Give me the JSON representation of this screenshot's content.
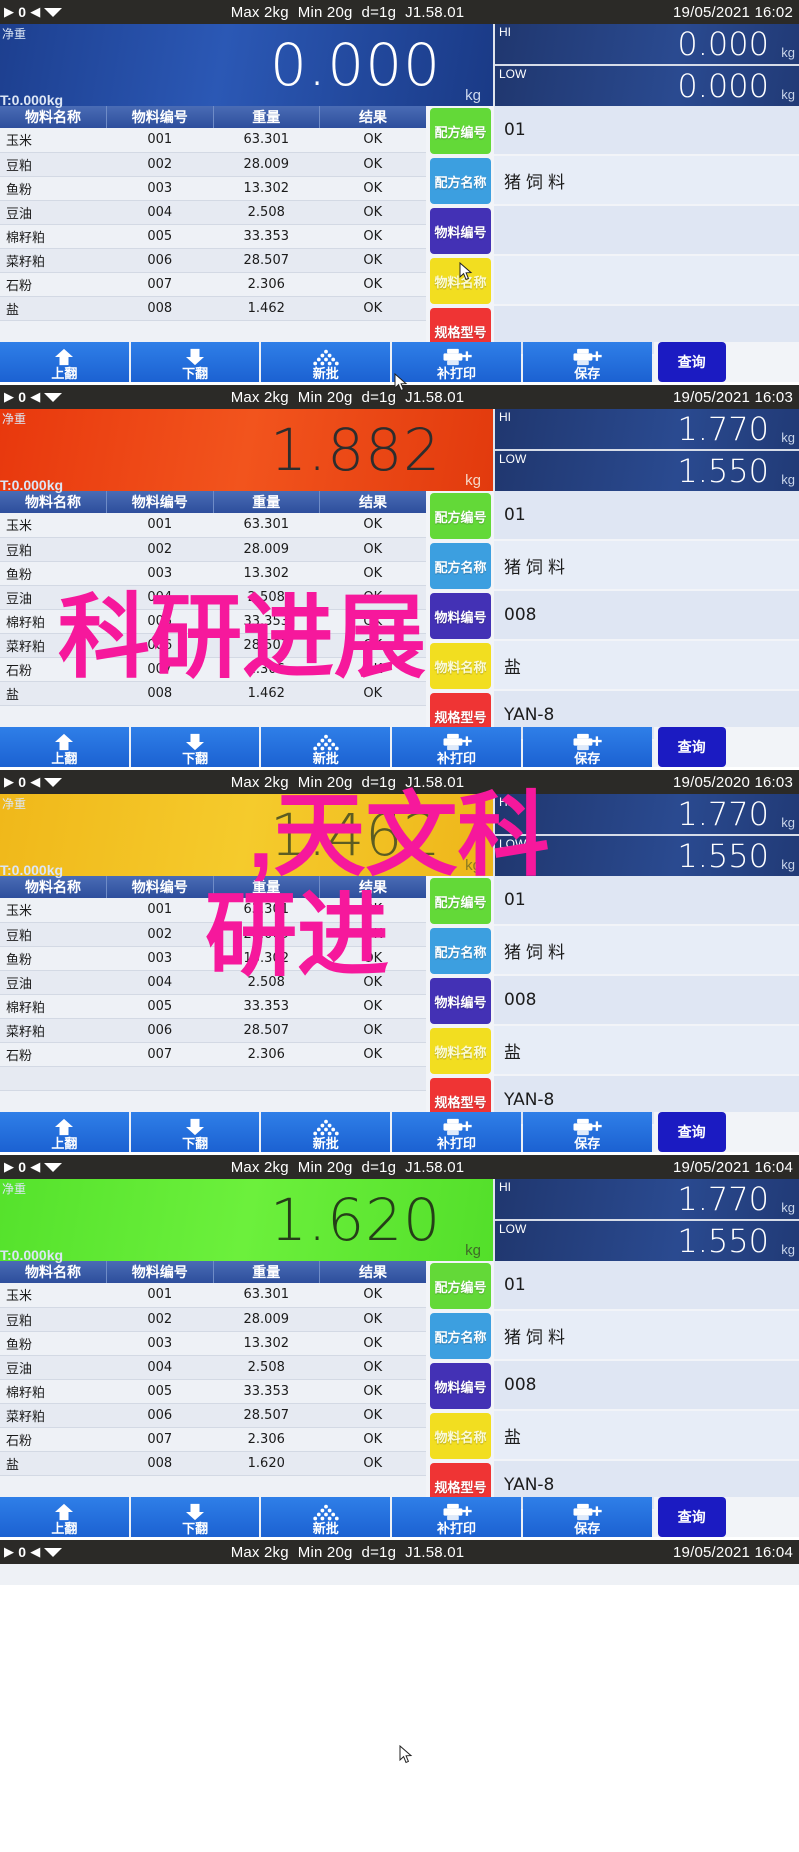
{
  "statusbar": {
    "indicator_zero": "0",
    "spec_max": "Max 2kg",
    "spec_min": "Min 20g",
    "spec_d": "d=1g",
    "firmware": "J1.58.01"
  },
  "table_headers": [
    "物料名称",
    "物料编号",
    "重量",
    "结果"
  ],
  "labels": {
    "net": "净重",
    "tare": "T:0.000kg",
    "unit_kg": "kg",
    "hi": "HI",
    "low": "LOW"
  },
  "keys": {
    "formula_no": "配方编号",
    "formula_name": "配方名称",
    "material_no": "物料编号",
    "material_name": "物料名称",
    "spec_model": "规格型号",
    "query": "查询"
  },
  "toolbar": [
    {
      "label": "上翻",
      "icon": "arrow-up-icon"
    },
    {
      "label": "下翻",
      "icon": "arrow-down-icon"
    },
    {
      "label": "新批",
      "icon": "stack-icon"
    },
    {
      "label": "补打印",
      "icon": "printer-plus-icon"
    },
    {
      "label": "保存",
      "icon": "printer-save-icon"
    }
  ],
  "panels": [
    {
      "id": "panel-1",
      "datetime": "19/05/2021 16:02",
      "weight": "0.000",
      "weight_color": "blue",
      "hi": "0.000",
      "low": "0.000",
      "rows": [
        [
          "玉米",
          "001",
          "63.301",
          "OK"
        ],
        [
          "豆粕",
          "002",
          "28.009",
          "OK"
        ],
        [
          "鱼粉",
          "003",
          "13.302",
          "OK"
        ],
        [
          "豆油",
          "004",
          "2.508",
          "OK"
        ],
        [
          "棉籽粕",
          "005",
          "33.353",
          "OK"
        ],
        [
          "菜籽粕",
          "006",
          "28.507",
          "OK"
        ],
        [
          "石粉",
          "007",
          "2.306",
          "OK"
        ],
        [
          "盐",
          "008",
          "1.462",
          "OK"
        ]
      ],
      "values": {
        "formula_no": "01",
        "formula_name": "猪饲料",
        "material_no": "",
        "material_name": "",
        "spec_model": ""
      }
    },
    {
      "id": "panel-2",
      "datetime": "19/05/2021 16:03",
      "weight": "1.882",
      "weight_color": "red",
      "hi": "1.770",
      "low": "1.550",
      "rows": [
        [
          "玉米",
          "001",
          "63.301",
          "OK"
        ],
        [
          "豆粕",
          "002",
          "28.009",
          "OK"
        ],
        [
          "鱼粉",
          "003",
          "13.302",
          "OK"
        ],
        [
          "豆油",
          "004",
          "2.508",
          "OK"
        ],
        [
          "棉籽粕",
          "005",
          "33.353",
          "OK"
        ],
        [
          "菜籽粕",
          "006",
          "28.507",
          "OK"
        ],
        [
          "石粉",
          "007",
          "2.306",
          "OK"
        ],
        [
          "盐",
          "008",
          "1.462",
          "OK"
        ]
      ],
      "values": {
        "formula_no": "01",
        "formula_name": "猪饲料",
        "material_no": "008",
        "material_name": "盐",
        "spec_model": "YAN-8"
      }
    },
    {
      "id": "panel-3",
      "datetime": "19/05/2020 16:03",
      "weight": "1.462",
      "weight_color": "yellow",
      "hi": "1.770",
      "low": "1.550",
      "rows": [
        [
          "玉米",
          "001",
          "63.301",
          "OK"
        ],
        [
          "豆粕",
          "002",
          "28.009",
          "OK"
        ],
        [
          "鱼粉",
          "003",
          "13.302",
          "OK"
        ],
        [
          "豆油",
          "004",
          "2.508",
          "OK"
        ],
        [
          "棉籽粕",
          "005",
          "33.353",
          "OK"
        ],
        [
          "菜籽粕",
          "006",
          "28.507",
          "OK"
        ],
        [
          "石粉",
          "007",
          "2.306",
          "OK"
        ],
        [
          "",
          "",
          "",
          ""
        ]
      ],
      "values": {
        "formula_no": "01",
        "formula_name": "猪饲料",
        "material_no": "008",
        "material_name": "盐",
        "spec_model": "YAN-8"
      }
    },
    {
      "id": "panel-4",
      "datetime": "19/05/2021 16:04",
      "weight": "1.620",
      "weight_color": "green",
      "hi": "1.770",
      "low": "1.550",
      "rows": [
        [
          "玉米",
          "001",
          "63.301",
          "OK"
        ],
        [
          "豆粕",
          "002",
          "28.009",
          "OK"
        ],
        [
          "鱼粉",
          "003",
          "13.302",
          "OK"
        ],
        [
          "豆油",
          "004",
          "2.508",
          "OK"
        ],
        [
          "棉籽粕",
          "005",
          "33.353",
          "OK"
        ],
        [
          "菜籽粕",
          "006",
          "28.507",
          "OK"
        ],
        [
          "石粉",
          "007",
          "2.306",
          "OK"
        ],
        [
          "盐",
          "008",
          "1.620",
          "OK"
        ]
      ],
      "values": {
        "formula_no": "01",
        "formula_name": "猪饲料",
        "material_no": "008",
        "material_name": "盐",
        "spec_model": "YAN-8"
      }
    },
    {
      "id": "panel-5",
      "datetime": "19/05/2021 16:04",
      "weight": "",
      "weight_color": "blue",
      "hi": "",
      "low": "",
      "rows": [],
      "values": {}
    }
  ],
  "overlay_text": {
    "line1": "科研进展",
    "line2": ",天文科",
    "line3": "研进",
    "color": "#f6189c"
  }
}
